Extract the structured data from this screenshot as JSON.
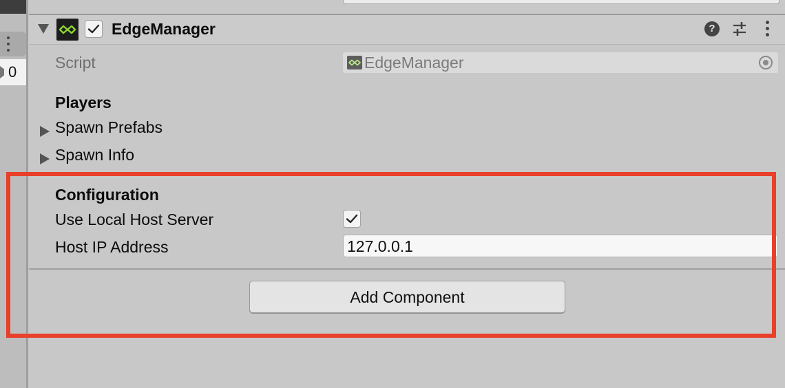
{
  "left_panel": {
    "count": "0"
  },
  "component": {
    "title": "EdgeManager",
    "enabled": true,
    "help_symbol": "?"
  },
  "script_row": {
    "label": "Script",
    "value": "EdgeManager"
  },
  "players": {
    "heading": "Players",
    "items": [
      {
        "label": "Spawn Prefabs",
        "expanded": false
      },
      {
        "label": "Spawn Info",
        "expanded": false
      }
    ]
  },
  "configuration": {
    "heading": "Configuration",
    "use_local_host_label": "Use Local Host Server",
    "use_local_host_checked": true,
    "host_ip_label": "Host IP Address",
    "host_ip_value": "127.0.0.1"
  },
  "add_component_label": "Add Component",
  "colors": {
    "background": "#c8c8c8",
    "highlight": "#e9402a",
    "icon_accent": "#8dd534"
  },
  "icons": [
    "fold-arrow-icon",
    "edge-manager-icon",
    "help-icon",
    "sliders-icon",
    "kebab-menu-icon",
    "object-picker-icon",
    "checkmark-icon"
  ]
}
